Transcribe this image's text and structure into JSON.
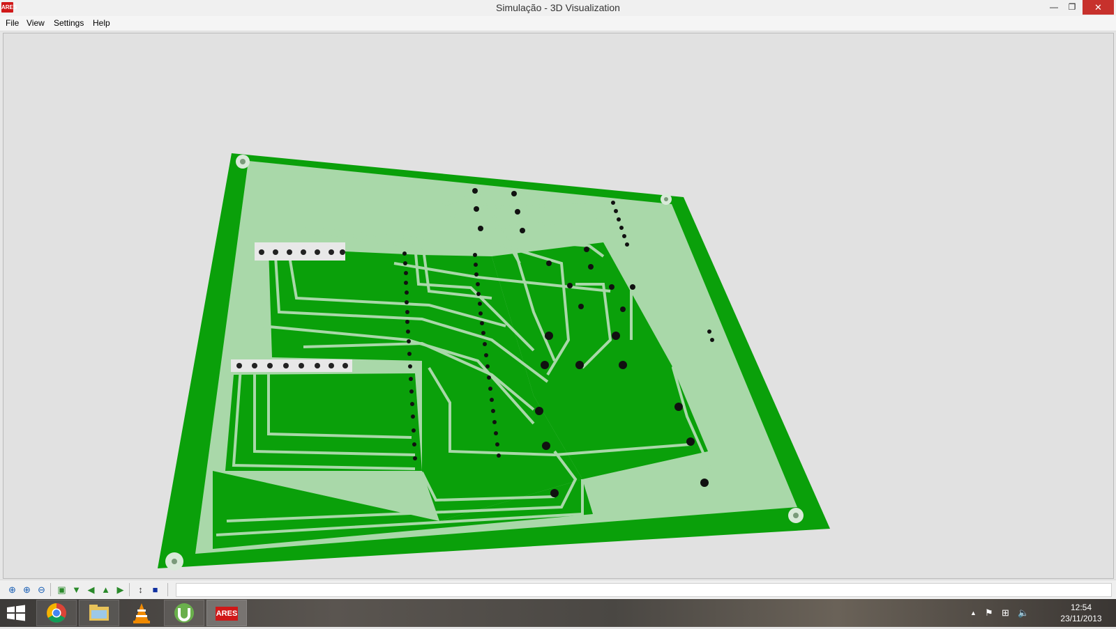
{
  "window": {
    "title": "Simulação - 3D Visualization",
    "app_icon_text": "ARES",
    "minimize_glyph": "—",
    "maximize_glyph": "❐",
    "close_glyph": "✕"
  },
  "menu": [
    {
      "label": "File"
    },
    {
      "label": "View"
    },
    {
      "label": "Settings"
    },
    {
      "label": "Help"
    }
  ],
  "viewport": {
    "background": "#e1e1e1",
    "board_color": "#0aa00a",
    "board_light_color": "#a9d8a9",
    "content": "3D PCB render"
  },
  "toolbar": {
    "buttons": [
      {
        "icon": "pan-crosshair-icon",
        "glyph": "⊕"
      },
      {
        "icon": "zoom-in-icon",
        "glyph": "⊕"
      },
      {
        "icon": "zoom-out-icon",
        "glyph": "⊖"
      },
      {
        "icon": "view-top-icon",
        "glyph": "▣"
      },
      {
        "icon": "view-front-icon",
        "glyph": "▼"
      },
      {
        "icon": "view-left-icon",
        "glyph": "◀"
      },
      {
        "icon": "view-back-icon",
        "glyph": "▲"
      },
      {
        "icon": "view-right-icon",
        "glyph": "▶"
      },
      {
        "icon": "height-toggle-icon",
        "glyph": "↕"
      },
      {
        "icon": "component-toggle-icon",
        "glyph": "■"
      }
    ]
  },
  "taskbar": {
    "apps": [
      {
        "name": "chrome-icon"
      },
      {
        "name": "file-explorer-icon"
      },
      {
        "name": "vlc-icon"
      },
      {
        "name": "utorrent-icon"
      },
      {
        "name": "ares-icon",
        "text": "ARES"
      }
    ],
    "tray": [
      {
        "name": "show-hidden-icons",
        "glyph": "▲"
      },
      {
        "name": "action-center-flag-icon",
        "glyph": "⚑"
      },
      {
        "name": "network-icon",
        "glyph": "⊞"
      },
      {
        "name": "volume-icon",
        "glyph": "🔈"
      }
    ],
    "time": "12:54",
    "date": "23/11/2013"
  }
}
